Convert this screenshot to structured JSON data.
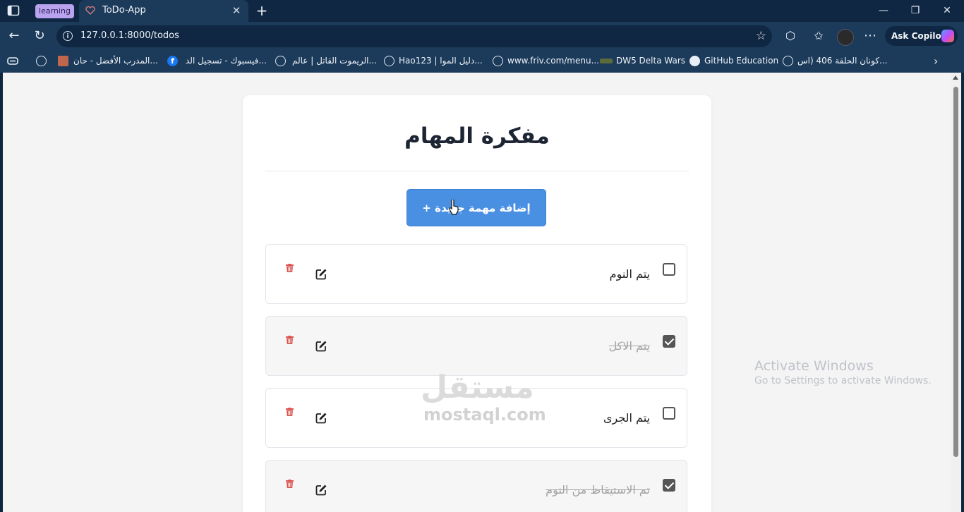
{
  "browser": {
    "group_chip": "learning",
    "tab_title": "ToDo-App",
    "url": "127.0.0.1:8000/todos",
    "copilot_label": "Ask Copilot",
    "bookmarks": [
      "المدرب الأفضل - حان...",
      "فيسبوك - تسجيل الد...",
      "الريموت القاتل | عالم...",
      "Hao123 | دليل الموا...",
      "www.friv.com/menu...",
      "DW5 Delta Wars",
      "GitHub Education",
      "كونان الحلقة 406 (اس..."
    ],
    "icons": [
      "sidebar-icon",
      "tab-close-icon",
      "new-tab-icon",
      "minimize-icon",
      "restore-icon",
      "close-icon",
      "back-icon",
      "refresh-icon",
      "info-icon",
      "star-icon",
      "extensions-icon",
      "favorites-icon",
      "more-icon"
    ]
  },
  "app": {
    "title": "مفكرة المهام",
    "add_button_label": "إضافة مهمة جديدة +",
    "todos": [
      {
        "text": "يتم النوم",
        "done": false
      },
      {
        "text": "يتم الاكل",
        "done": true
      },
      {
        "text": "يتم الجرى",
        "done": false
      },
      {
        "text": "تم الاستيقاظ من النوم",
        "done": true
      }
    ],
    "delete_color": "#d9534f",
    "accent": "#4a90e2"
  },
  "overlay": {
    "activate_title": "Activate Windows",
    "activate_sub": "Go to Settings to activate Windows.",
    "watermark_ar": "مستقل",
    "watermark_latin": "mostaql.com"
  }
}
